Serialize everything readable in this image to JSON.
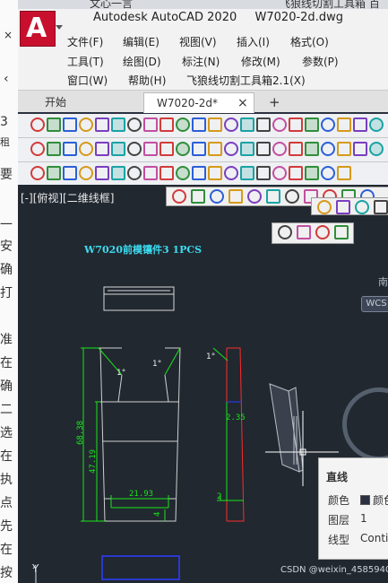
{
  "app": {
    "title": "Autodesk AutoCAD 2020",
    "document": "W7020-2d.dwg"
  },
  "browser": {
    "tabs": [
      "文心一言",
      "飞狼线切割工具箱 百度"
    ]
  },
  "left_panel": {
    "chars": [
      "3",
      "租",
      "要",
      "一",
      "安",
      "确",
      "打",
      "准",
      "在",
      "确",
      "二",
      "选",
      "在",
      "执",
      "点",
      "先",
      "在",
      "按"
    ]
  },
  "menu": {
    "row1": [
      "文件(F)",
      "编辑(E)",
      "视图(V)",
      "插入(I)",
      "格式(O)"
    ],
    "row2": [
      "工具(T)",
      "绘图(D)",
      "标注(N)",
      "修改(M)",
      "参数(P)"
    ],
    "row3": [
      "窗口(W)",
      "帮助(H)",
      "飞狼线切割工具箱2.1(X)"
    ]
  },
  "doc_tabs": {
    "start": "开始",
    "active": "W7020-2d*",
    "close": "×",
    "add": "+"
  },
  "viewport": {
    "label": "[-][俯视][二维线框]",
    "compass_side": "南",
    "wcs": "WCS"
  },
  "drawing": {
    "title": "W7020前模镶件3  1PCS",
    "dim_height": "68.38",
    "dim_inner": "47.19",
    "dim_bottom": "21.93",
    "dim_small": "4",
    "dim_side": "2.35",
    "dim_side2": "2",
    "angle1": "1°",
    "angle2": "1°",
    "angle3": "1°",
    "axis_y": "Y"
  },
  "properties": {
    "title": "直线",
    "color_label": "颜色",
    "color_value": "颜色",
    "layer_label": "图层",
    "layer_value": "1",
    "linetype_label": "线型",
    "linetype_value": "Conti"
  },
  "watermark": "CSDN @weixin_45859408",
  "colors": {
    "accent_red": "#c8102e",
    "canvas_bg": "#212830",
    "geometry_green": "#19e619",
    "geometry_cyan": "#3cdcf0",
    "geometry_red": "#ff2a2a",
    "geometry_blue": "#2c3fff"
  }
}
